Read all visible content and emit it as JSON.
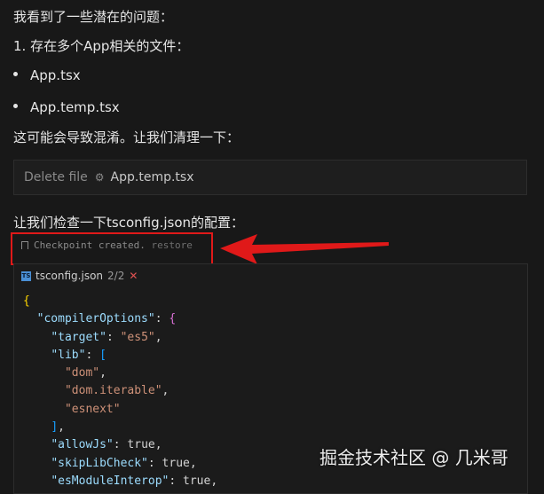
{
  "messages": {
    "intro": "我看到了一些潜在的问题：",
    "point1": "1. 存在多个App相关的文件：",
    "bullets": [
      "App.tsx",
      "App.temp.tsx"
    ],
    "confusion": "这可能会导致混淆。让我们清理一下：",
    "check_tsconfig": "让我们检查一下tsconfig.json的配置："
  },
  "delete_action": {
    "label": "Delete file",
    "file": "App.temp.tsx",
    "icon": "gear-icon"
  },
  "checkpoint": {
    "text": "Checkpoint created.",
    "restore": "restore",
    "icon": "bookmark-icon"
  },
  "code_panel": {
    "filename": "tsconfig.json",
    "count": "2/2",
    "close": "✕",
    "file_icon_text": "TS",
    "lines": [
      [
        {
          "t": "{",
          "c": "b"
        }
      ],
      [
        {
          "t": "  ",
          "c": "p"
        },
        {
          "t": "\"compilerOptions\"",
          "c": "k"
        },
        {
          "t": ": ",
          "c": "p"
        },
        {
          "t": "{",
          "c": "b2"
        }
      ],
      [
        {
          "t": "    ",
          "c": "p"
        },
        {
          "t": "\"target\"",
          "c": "k"
        },
        {
          "t": ": ",
          "c": "p"
        },
        {
          "t": "\"es5\"",
          "c": "s"
        },
        {
          "t": ",",
          "c": "p"
        }
      ],
      [
        {
          "t": "    ",
          "c": "p"
        },
        {
          "t": "\"lib\"",
          "c": "k"
        },
        {
          "t": ": ",
          "c": "p"
        },
        {
          "t": "[",
          "c": "b3"
        }
      ],
      [
        {
          "t": "      ",
          "c": "p"
        },
        {
          "t": "\"dom\"",
          "c": "s"
        },
        {
          "t": ",",
          "c": "p"
        }
      ],
      [
        {
          "t": "      ",
          "c": "p"
        },
        {
          "t": "\"dom.iterable\"",
          "c": "s"
        },
        {
          "t": ",",
          "c": "p"
        }
      ],
      [
        {
          "t": "      ",
          "c": "p"
        },
        {
          "t": "\"esnext\"",
          "c": "s"
        }
      ],
      [
        {
          "t": "    ",
          "c": "p"
        },
        {
          "t": "]",
          "c": "b3"
        },
        {
          "t": ",",
          "c": "p"
        }
      ],
      [
        {
          "t": "    ",
          "c": "p"
        },
        {
          "t": "\"allowJs\"",
          "c": "k"
        },
        {
          "t": ": true,",
          "c": "p"
        }
      ],
      [
        {
          "t": "    ",
          "c": "p"
        },
        {
          "t": "\"skipLibCheck\"",
          "c": "k"
        },
        {
          "t": ": true,",
          "c": "p"
        }
      ],
      [
        {
          "t": "    ",
          "c": "p"
        },
        {
          "t": "\"esModuleInterop\"",
          "c": "k"
        },
        {
          "t": ": true,",
          "c": "p"
        }
      ]
    ]
  },
  "watermark": "掘金技术社区 @ 几米哥",
  "colors": {
    "background": "#181818",
    "annotation_red": "#e01919",
    "json_key": "#9cdcfe",
    "json_string": "#ce9178"
  }
}
